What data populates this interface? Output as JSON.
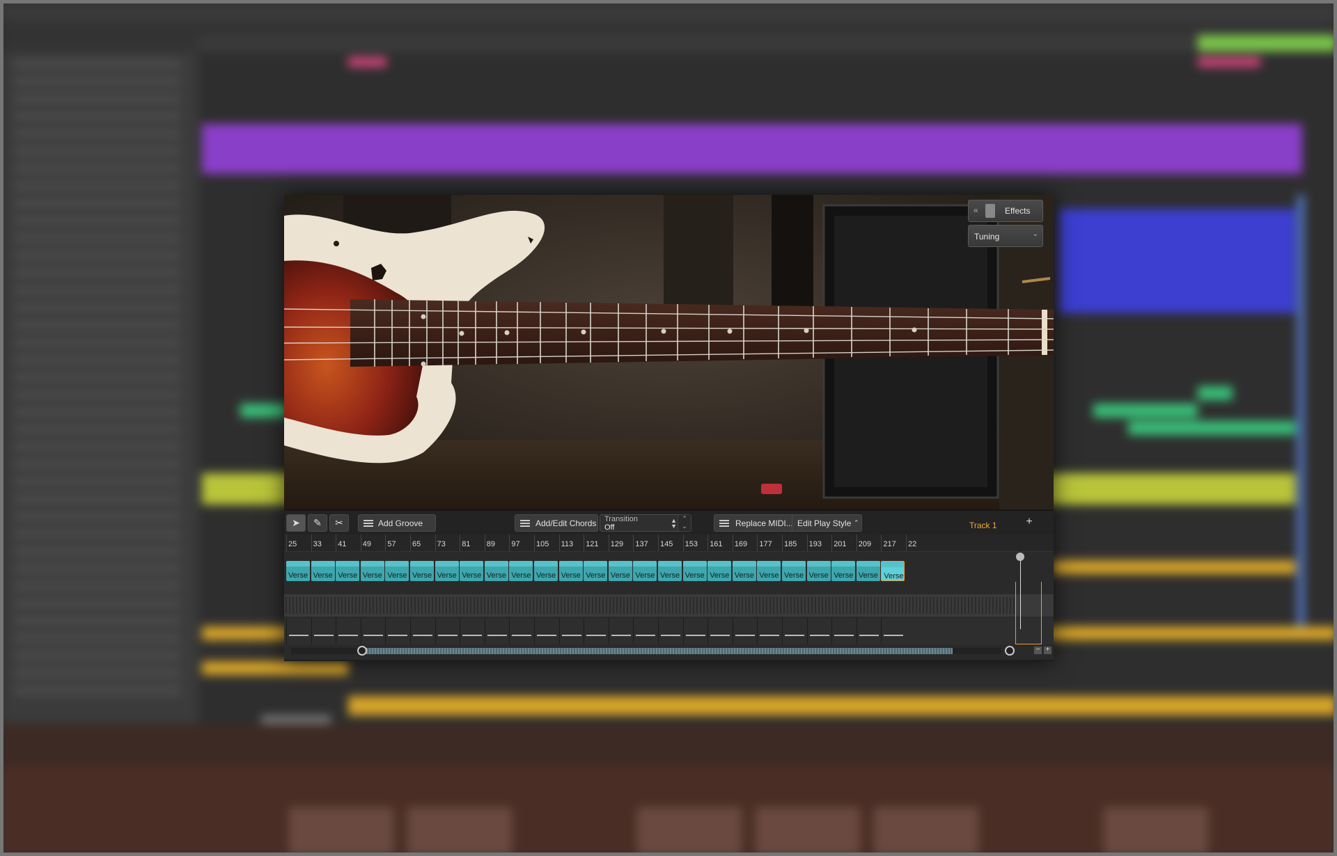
{
  "plugin": {
    "effects_label": "Effects",
    "tuning_label": "Tuning"
  },
  "toolbar": {
    "add_groove": "Add Groove",
    "add_chords": "Add/Edit Chords",
    "transition_label": "Transition",
    "transition_value": "Off",
    "replace_midi": "Replace MIDI...",
    "edit_play_style": "Edit Play Style",
    "track_name": "Track 1",
    "add_track": "+"
  },
  "timeline": {
    "bars": [
      "25",
      "33",
      "41",
      "49",
      "57",
      "65",
      "73",
      "81",
      "89",
      "97",
      "105",
      "113",
      "121",
      "129",
      "137",
      "145",
      "153",
      "161",
      "169",
      "177",
      "185",
      "193",
      "201",
      "209",
      "217",
      "22"
    ],
    "clip_label": "Verse",
    "clip_count": 25,
    "selected_clip_index": 24
  },
  "colors": {
    "accent_orange": "#f09a3a",
    "clip_teal": "#3fa6ad",
    "clip_selected": "#5fd0d8"
  },
  "icons": {
    "select_tool": "arrow-cursor-icon",
    "pencil_tool": "pencil-icon",
    "scissors_tool": "scissors-icon",
    "effects": "pedal-icon"
  }
}
